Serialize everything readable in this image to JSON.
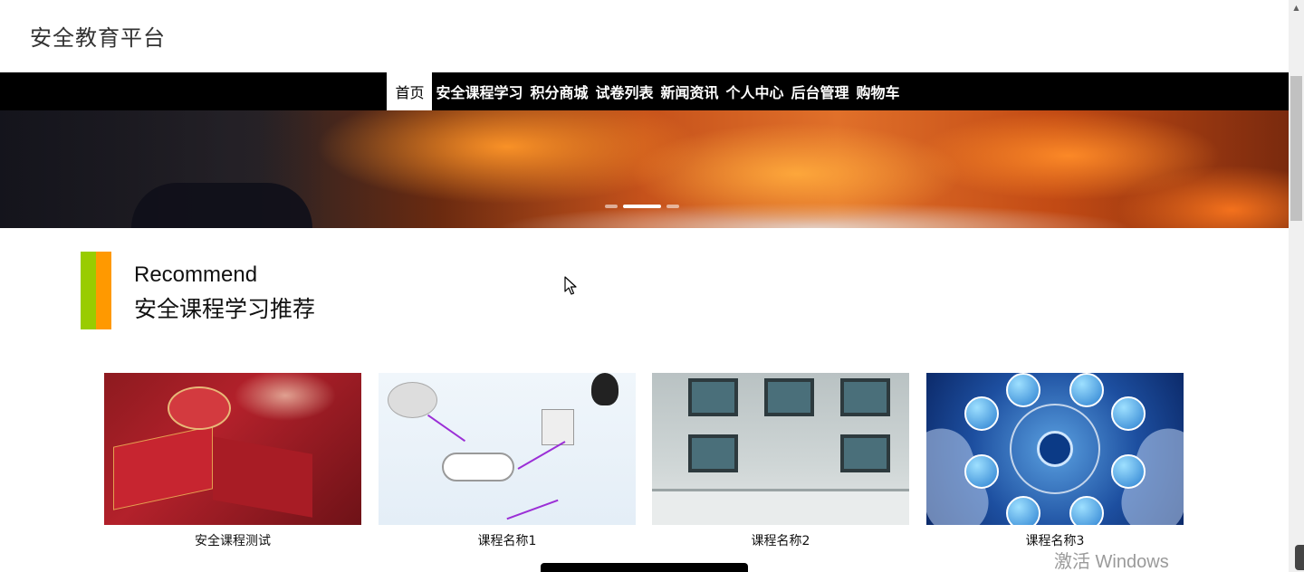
{
  "site": {
    "title": "安全教育平台"
  },
  "nav": {
    "items": [
      {
        "label": "首页",
        "active": true
      },
      {
        "label": "安全课程学习",
        "active": false
      },
      {
        "label": "积分商城",
        "active": false
      },
      {
        "label": "试卷列表",
        "active": false
      },
      {
        "label": "新闻资讯",
        "active": false
      },
      {
        "label": "个人中心",
        "active": false
      },
      {
        "label": "后台管理",
        "active": false
      },
      {
        "label": "购物车",
        "active": false
      }
    ]
  },
  "banner": {
    "slide_count": 3,
    "active_slide": 2
  },
  "section": {
    "title_en": "Recommend",
    "title_cn": "安全课程学习推荐",
    "bar_colors": [
      "#99cc00",
      "#ff9900"
    ]
  },
  "courses": [
    {
      "name": "安全课程测试"
    },
    {
      "name": "课程名称1"
    },
    {
      "name": "课程名称2"
    },
    {
      "name": "课程名称3"
    }
  ],
  "watermark": {
    "text": "激活 Windows"
  },
  "icons": {
    "cursor": "mouse-pointer-icon",
    "scroll_up": "scroll-up-arrow-icon"
  },
  "colors": {
    "nav_bg": "#000000",
    "accent_green": "#99cc00",
    "accent_orange": "#ff9900"
  }
}
